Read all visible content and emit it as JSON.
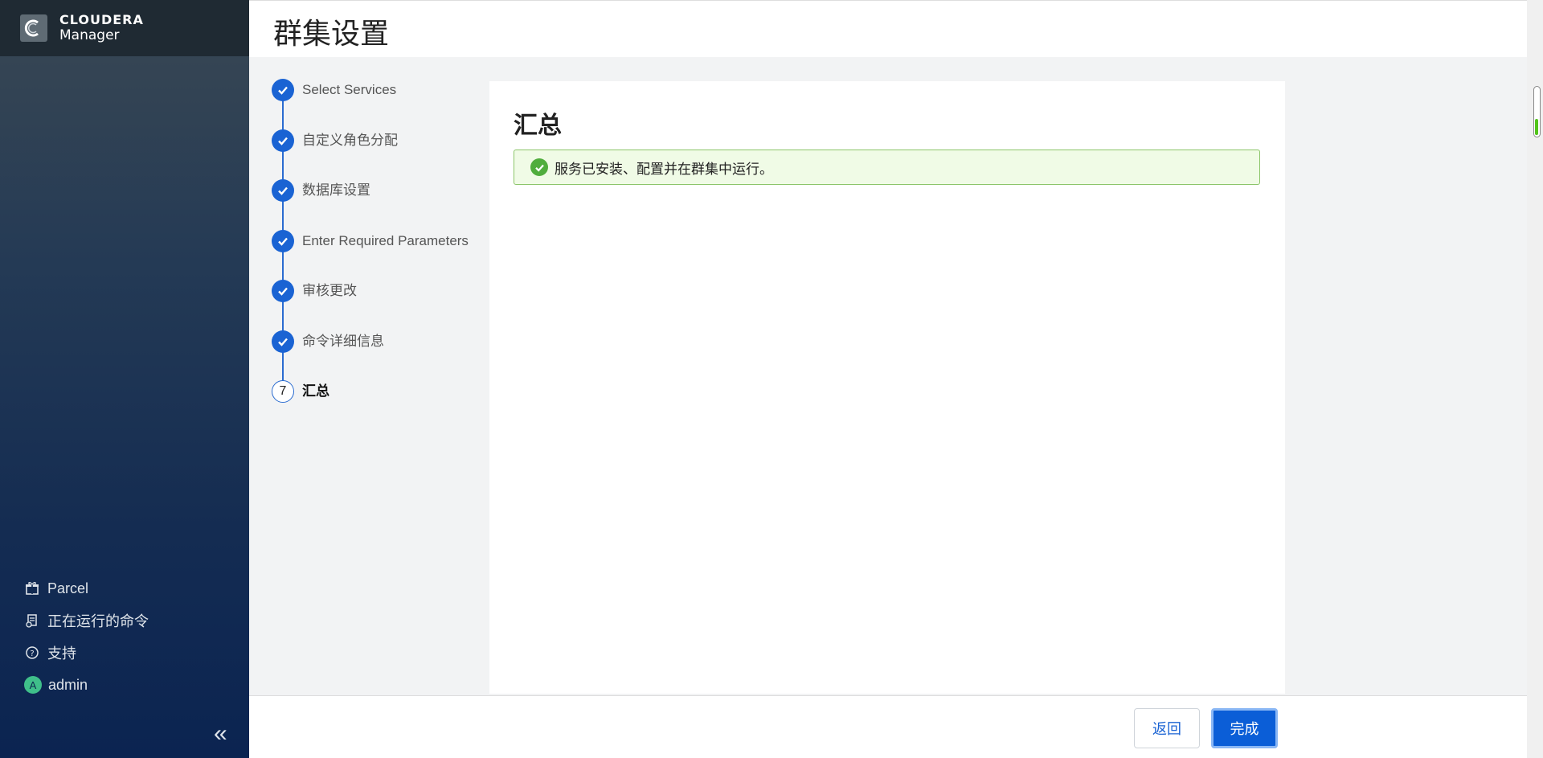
{
  "app": {
    "brand": "CLOUDERA",
    "product": "Manager"
  },
  "sidebar": {
    "items": [
      {
        "label": "Parcel",
        "icon": "parcel-icon"
      },
      {
        "label": "正在运行的命令",
        "icon": "running-commands-icon"
      },
      {
        "label": "支持",
        "icon": "help-icon"
      },
      {
        "label": "admin",
        "icon": "avatar",
        "avatar_letter": "A"
      }
    ],
    "collapse_glyph": "«"
  },
  "header": {
    "title": "群集设置"
  },
  "steps": [
    {
      "label": "Select Services",
      "state": "done"
    },
    {
      "label": "自定义角色分配",
      "state": "done"
    },
    {
      "label": "数据库设置",
      "state": "done"
    },
    {
      "label": "Enter Required Parameters",
      "state": "done"
    },
    {
      "label": "审核更改",
      "state": "done"
    },
    {
      "label": "命令详细信息",
      "state": "done"
    },
    {
      "label": "汇总",
      "state": "current",
      "number": "7"
    }
  ],
  "main": {
    "title": "汇总",
    "alert": {
      "type": "success",
      "message": "服务已安装、配置并在群集中运行。"
    }
  },
  "footer": {
    "back_label": "返回",
    "finish_label": "完成"
  },
  "colors": {
    "primary": "#0b5ed7",
    "success": "#50ad3d",
    "sidebar_dark": "#0b2451"
  }
}
